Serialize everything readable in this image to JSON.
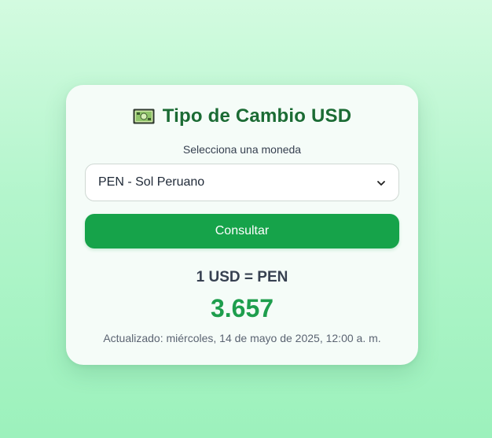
{
  "header": {
    "title": "Tipo de Cambio USD",
    "icon": "money-bill-icon"
  },
  "form": {
    "label": "Selecciona una moneda",
    "selected": "PEN - Sol Peruano",
    "button_label": "Consultar"
  },
  "result": {
    "pair": "1 USD = PEN",
    "rate": "3.657",
    "updated": "Actualizado: miércoles, 14 de mayo de 2025, 12:00 a. m."
  },
  "colors": {
    "accent": "#16a34a",
    "title": "#1b6b34",
    "rate": "#1e9e4d",
    "background": "#b3f5cc"
  }
}
